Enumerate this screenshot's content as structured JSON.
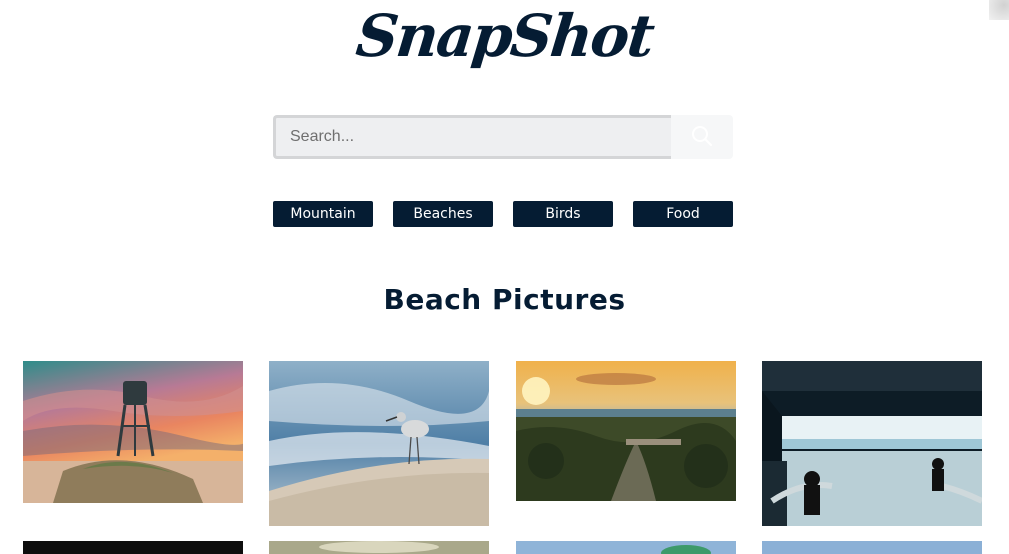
{
  "logo": {
    "text": "SnapShot"
  },
  "search": {
    "placeholder": "Search...",
    "icon": "search-icon"
  },
  "categories": [
    {
      "label": "Mountain"
    },
    {
      "label": "Beaches"
    },
    {
      "label": "Birds"
    },
    {
      "label": "Food"
    }
  ],
  "gallery": {
    "title": "Beach Pictures",
    "photos": [
      {
        "subject": "water tower on sand dune at sunset"
      },
      {
        "subject": "sandpiper bird on beach"
      },
      {
        "subject": "coastal town and river at sunset"
      },
      {
        "subject": "beach seen from under a pier"
      },
      {
        "subject": "dark photo"
      },
      {
        "subject": "hazy beach"
      },
      {
        "subject": "sky with green"
      },
      {
        "subject": "blue sky"
      }
    ]
  },
  "colors": {
    "brand_navy": "#051c33",
    "search_bg": "#eeeff1",
    "search_border": "#d4d5d7"
  }
}
